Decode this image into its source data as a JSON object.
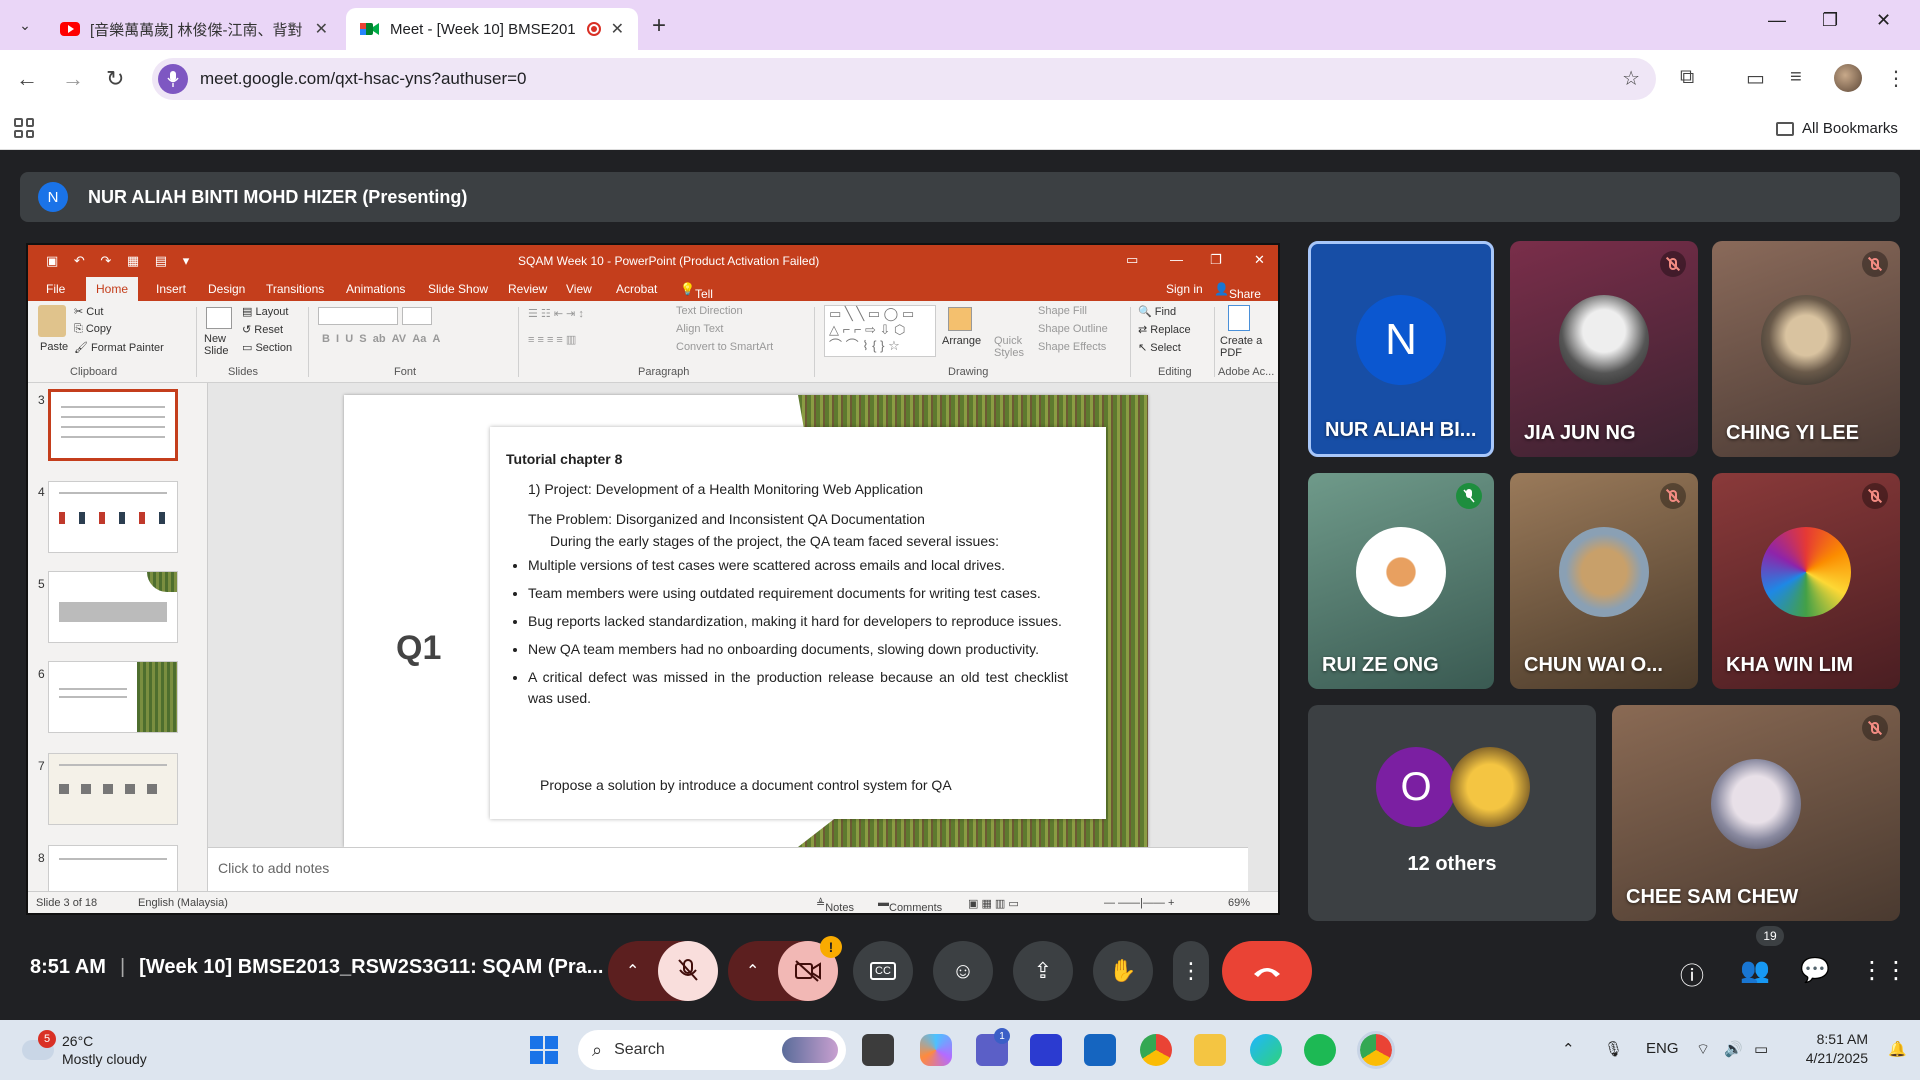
{
  "browser": {
    "tabs": [
      {
        "title": "[音樂萬萬歲] 林俊傑-江南、背對",
        "active": false,
        "favicon": "youtube-icon"
      },
      {
        "title": "Meet - [Week 10] BMSE201",
        "active": true,
        "favicon": "google-meet-icon"
      }
    ],
    "url": "meet.google.com/qxt-hsac-yns?authuser=0",
    "bookmarks_label": "All Bookmarks"
  },
  "meet": {
    "presenter": {
      "initial": "N",
      "label": "NUR ALIAH BINTI MOHD HIZER (Presenting)"
    },
    "participants": [
      {
        "name": "NUR ALIAH BI...",
        "initial": "N",
        "muted": false
      },
      {
        "name": "JIA JUN NG",
        "muted": true
      },
      {
        "name": "CHING YI LEE",
        "muted": true
      },
      {
        "name": "RUI ZE ONG",
        "speaking": true
      },
      {
        "name": "CHUN WAI O...",
        "muted": true
      },
      {
        "name": "KHA WIN LIM",
        "muted": true
      },
      {
        "name": "12 others",
        "initial": "O"
      },
      {
        "name": "CHEE SAM CHEW",
        "muted": true
      }
    ],
    "time": "8:51 AM",
    "meeting_title": "[Week 10] BMSE2013_RSW2S3G11: SQAM (Pra...",
    "people_count": "19",
    "camera_warning": "!"
  },
  "powerpoint": {
    "window_title": "SQAM Week 10 - PowerPoint (Product Activation Failed)",
    "menu": [
      "File",
      "Home",
      "Insert",
      "Design",
      "Transitions",
      "Animations",
      "Slide Show",
      "Review",
      "View",
      "Acrobat"
    ],
    "tell_me": "Tell me what you want to do...",
    "sign_in": "Sign in",
    "share": "Share",
    "ribbon": {
      "paste": "Paste",
      "cut": "Cut",
      "copy": "Copy",
      "format_painter": "Format Painter",
      "clipboard": "Clipboard",
      "new_slide": "New Slide",
      "layout": "Layout",
      "reset": "Reset",
      "section": "Section",
      "slides": "Slides",
      "font": "Font",
      "text_direction": "Text Direction",
      "align_text": "Align Text",
      "convert_smartart": "Convert to SmartArt",
      "paragraph": "Paragraph",
      "arrange": "Arrange",
      "quick_styles": "Quick Styles",
      "shape_fill": "Shape Fill",
      "shape_outline": "Shape Outline",
      "shape_effects": "Shape Effects",
      "drawing": "Drawing",
      "find": "Find",
      "replace": "Replace",
      "select": "Select",
      "editing": "Editing",
      "create_pdf": "Create a PDF",
      "adobe": "Adobe Ac..."
    },
    "thumb_numbers": [
      "3",
      "4",
      "5",
      "6",
      "7",
      "8"
    ],
    "slide": {
      "label": "Q1",
      "heading": "Tutorial chapter 8",
      "project": "1)   Project: Development of a Health Monitoring Web Application",
      "problem": "The Problem: Disorganized and Inconsistent QA Documentation",
      "intro": "During the early stages of the project, the QA team faced several issues:",
      "bullets": [
        "Multiple versions of test cases were scattered across emails and local drives.",
        "Team members were using outdated requirement documents for writing test cases.",
        "Bug reports lacked standardization, making it hard for developers to reproduce issues.",
        "New QA team members had no onboarding documents, slowing down productivity.",
        "A critical defect was missed in the production release because an old test checklist was used."
      ],
      "prompt": "Propose a solution by introduce a document control system for QA"
    },
    "notes_placeholder": "Click to add notes",
    "status": {
      "slide_of": "Slide 3 of 18",
      "language": "English (Malaysia)",
      "notes": "Notes",
      "comments": "Comments",
      "zoom": "69%"
    }
  },
  "taskbar": {
    "weather_temp": "26°C",
    "weather_desc": "Mostly cloudy",
    "weather_badge": "5",
    "search": "Search",
    "lang": "ENG",
    "time": "8:51 AM",
    "date": "4/21/2025",
    "teams_badge": "1"
  }
}
